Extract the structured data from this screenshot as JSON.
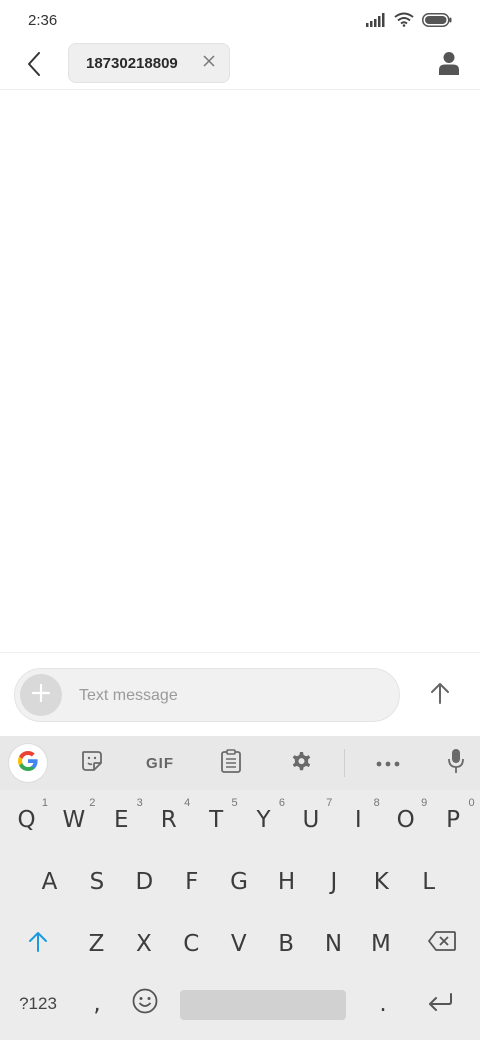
{
  "status_bar": {
    "time": "2:36"
  },
  "header": {
    "recipient": "18730218809",
    "icons": [
      "back-arrow-icon",
      "close-icon",
      "contact-person-icon"
    ]
  },
  "compose": {
    "placeholder": "Text message",
    "icons": [
      "plus-icon",
      "send-arrow-icon"
    ]
  },
  "keyboard": {
    "toolbar": {
      "gif_label": "GIF",
      "icons": [
        "google-icon",
        "sticker-icon",
        "clipboard-icon",
        "settings-icon",
        "more-icon",
        "microphone-icon"
      ]
    },
    "row1": [
      {
        "key": "Q",
        "hint": "1"
      },
      {
        "key": "W",
        "hint": "2"
      },
      {
        "key": "E",
        "hint": "3"
      },
      {
        "key": "R",
        "hint": "4"
      },
      {
        "key": "T",
        "hint": "5"
      },
      {
        "key": "Y",
        "hint": "6"
      },
      {
        "key": "U",
        "hint": "7"
      },
      {
        "key": "I",
        "hint": "8"
      },
      {
        "key": "O",
        "hint": "9"
      },
      {
        "key": "P",
        "hint": "0"
      }
    ],
    "row2": [
      "A",
      "S",
      "D",
      "F",
      "G",
      "H",
      "J",
      "K",
      "L"
    ],
    "row3": [
      "Z",
      "X",
      "C",
      "V",
      "B",
      "N",
      "M"
    ],
    "bottom": {
      "symbols_label": "?123",
      "comma": ",",
      "period": "."
    },
    "accent_color": "#1a9ae0"
  }
}
